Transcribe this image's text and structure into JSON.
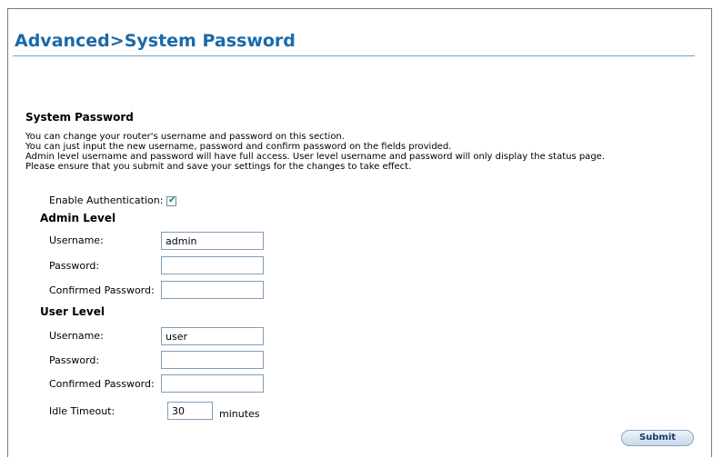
{
  "header": {
    "title": "Advanced>System Password"
  },
  "section": {
    "heading": "System Password",
    "description": [
      "You can change your router's username and password on this section.",
      "You can just input the new username, password and confirm password on the fields provided.",
      "Admin level username and password will have full access. User level username and password will only display the status page.",
      "Please ensure that you submit and save your settings for the changes to take effect."
    ]
  },
  "auth": {
    "label": "Enable Authentication:",
    "checked": true
  },
  "admin": {
    "heading": "Admin Level",
    "username_label": "Username:",
    "username_value": "admin",
    "password_label": "Password:",
    "password_value": "",
    "confirm_label": "Confirmed Password:",
    "confirm_value": ""
  },
  "user": {
    "heading": "User Level",
    "username_label": "Username:",
    "username_value": "user",
    "password_label": "Password:",
    "password_value": "",
    "confirm_label": "Confirmed Password:",
    "confirm_value": ""
  },
  "idle": {
    "label": "Idle Timeout:",
    "value": "30",
    "unit": "minutes"
  },
  "actions": {
    "submit_label": "Submit"
  },
  "colors": {
    "title": "#1a6aa8",
    "rule": "#6fa5cf",
    "check": "#2c8a2c"
  }
}
